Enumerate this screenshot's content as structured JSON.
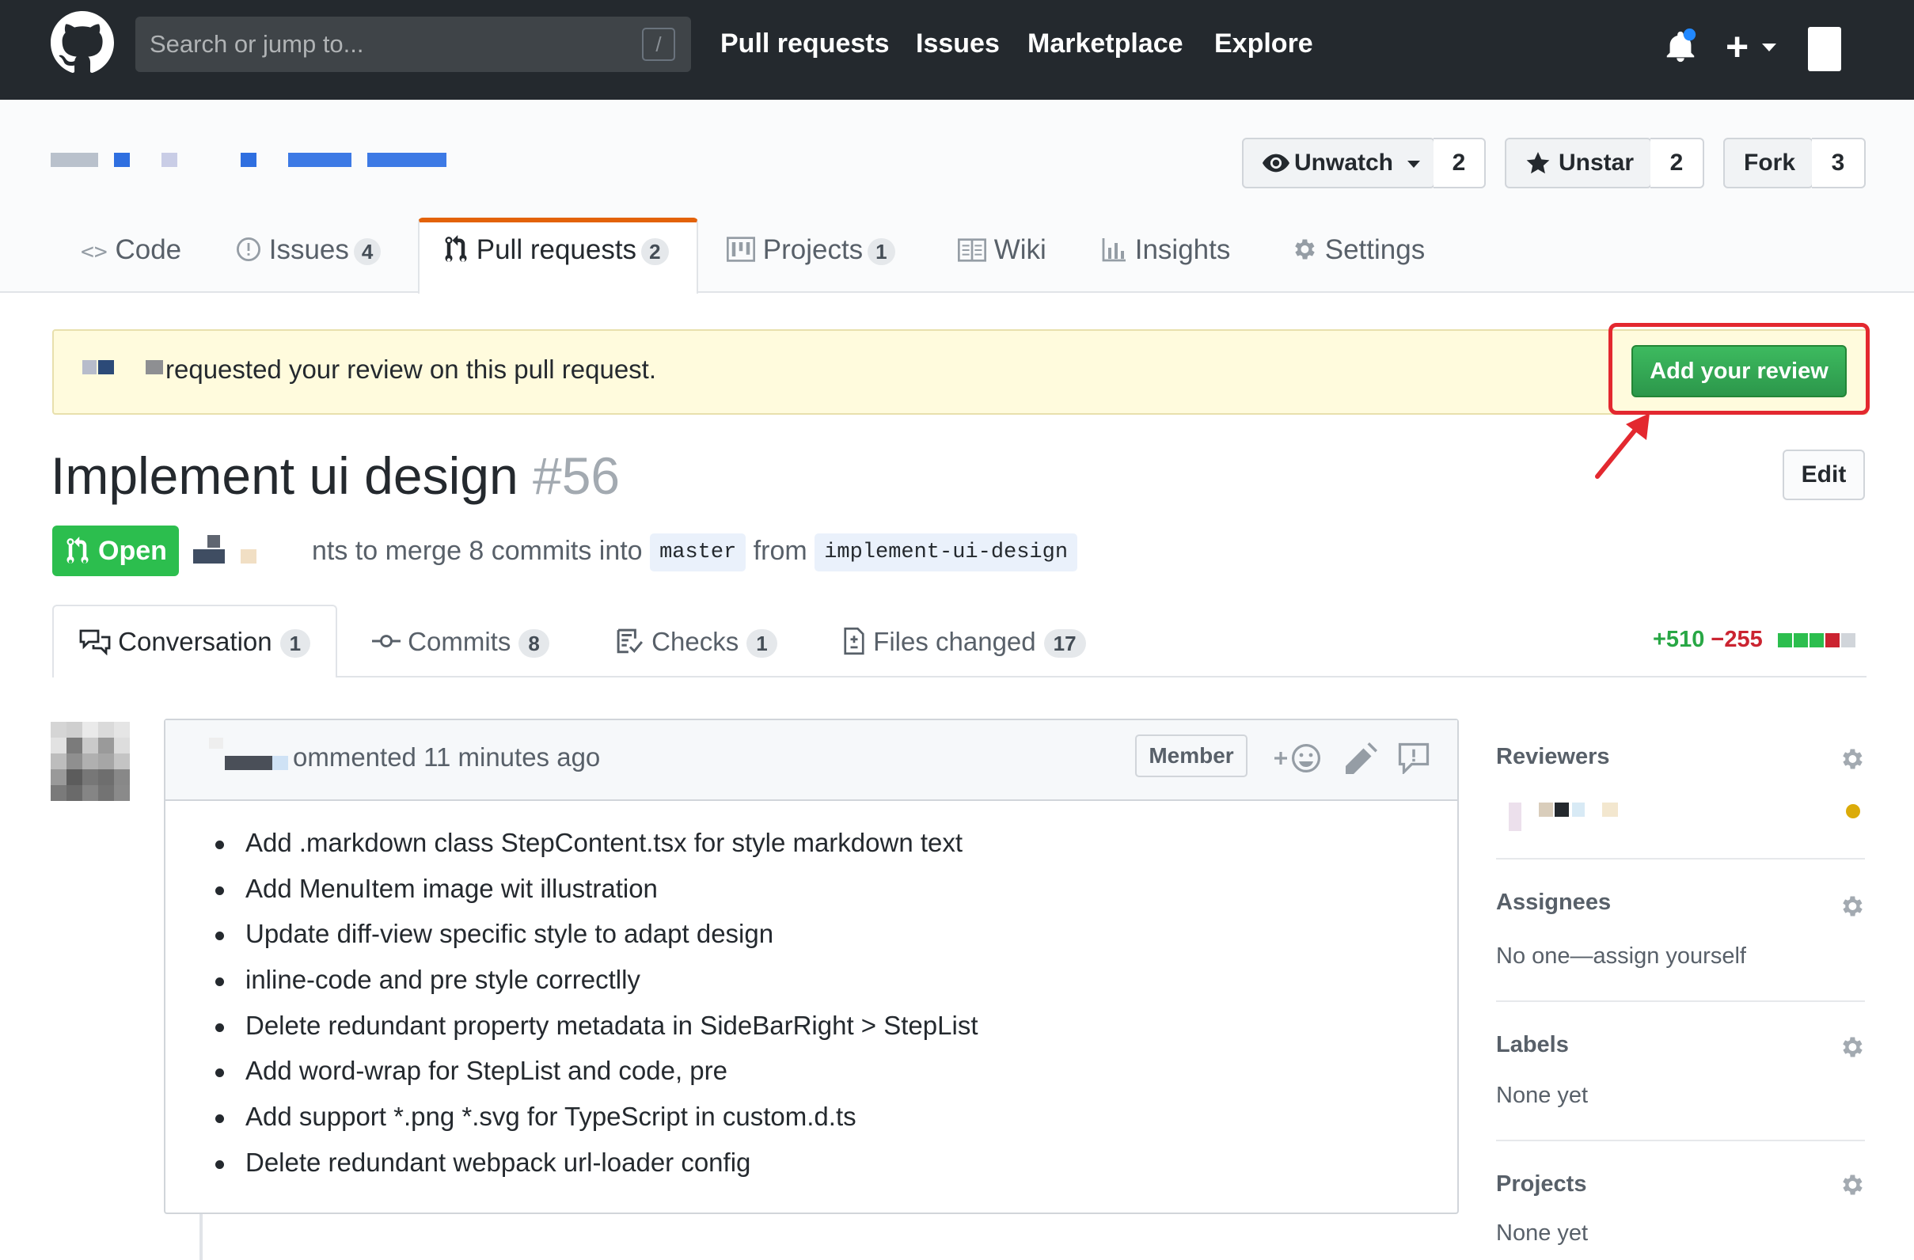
{
  "topbar": {
    "search_placeholder": "Search or jump to...",
    "slash_hint": "/",
    "nav": [
      "Pull requests",
      "Issues",
      "Marketplace",
      "Explore"
    ],
    "new_label": "+"
  },
  "repo_actions": {
    "watch_label": "Unwatch",
    "watch_count": "2",
    "star_label": "Unstar",
    "star_count": "2",
    "fork_label": "Fork",
    "fork_count": "3"
  },
  "repo_tabs": [
    {
      "label": "Code",
      "count": ""
    },
    {
      "label": "Issues",
      "count": "4"
    },
    {
      "label": "Pull requests",
      "count": "2"
    },
    {
      "label": "Projects",
      "count": "1"
    },
    {
      "label": "Wiki",
      "count": ""
    },
    {
      "label": "Insights",
      "count": ""
    },
    {
      "label": "Settings",
      "count": ""
    }
  ],
  "notice": {
    "text": "requested your review on this pull request.",
    "button": "Add your review"
  },
  "pr": {
    "title": "Implement ui design",
    "number": "#56",
    "edit_label": "Edit",
    "state": "Open",
    "meta_text": "nts to merge 8 commits into",
    "base_branch": "master",
    "from_word": "from",
    "head_branch": "implement-ui-design"
  },
  "pr_tabs": [
    {
      "label": "Conversation",
      "count": "1"
    },
    {
      "label": "Commits",
      "count": "8"
    },
    {
      "label": "Checks",
      "count": "1"
    },
    {
      "label": "Files changed",
      "count": "17"
    }
  ],
  "diffstat": {
    "additions": "+510",
    "deletions": "−255"
  },
  "comment": {
    "header_text": "ommented 11 minutes ago",
    "role_badge": "Member",
    "items": [
      "Add .markdown class StepContent.tsx for style markdown text",
      "Add MenuItem image wit illustration",
      "Update diff-view specific style to adapt design",
      "inline-code and pre style correctlly",
      "Delete redundant property metadata in SideBarRight > StepList",
      "Add word-wrap for StepList and code, pre",
      "Add support *.png *.svg for TypeScript in custom.d.ts",
      "Delete redundant webpack url-loader config"
    ]
  },
  "sidebar": {
    "reviewers_label": "Reviewers",
    "assignees_label": "Assignees",
    "assignees_value": "No one—assign yourself",
    "labels_label": "Labels",
    "labels_value": "None yet",
    "projects_label": "Projects",
    "projects_value": "None yet"
  },
  "colors": {
    "topbar": "#24292e",
    "green": "#2cbe4e",
    "red_highlight": "#e3282f",
    "add_color": "#28a745",
    "del_color": "#cb2431",
    "pending_dot": "#dbab09"
  }
}
